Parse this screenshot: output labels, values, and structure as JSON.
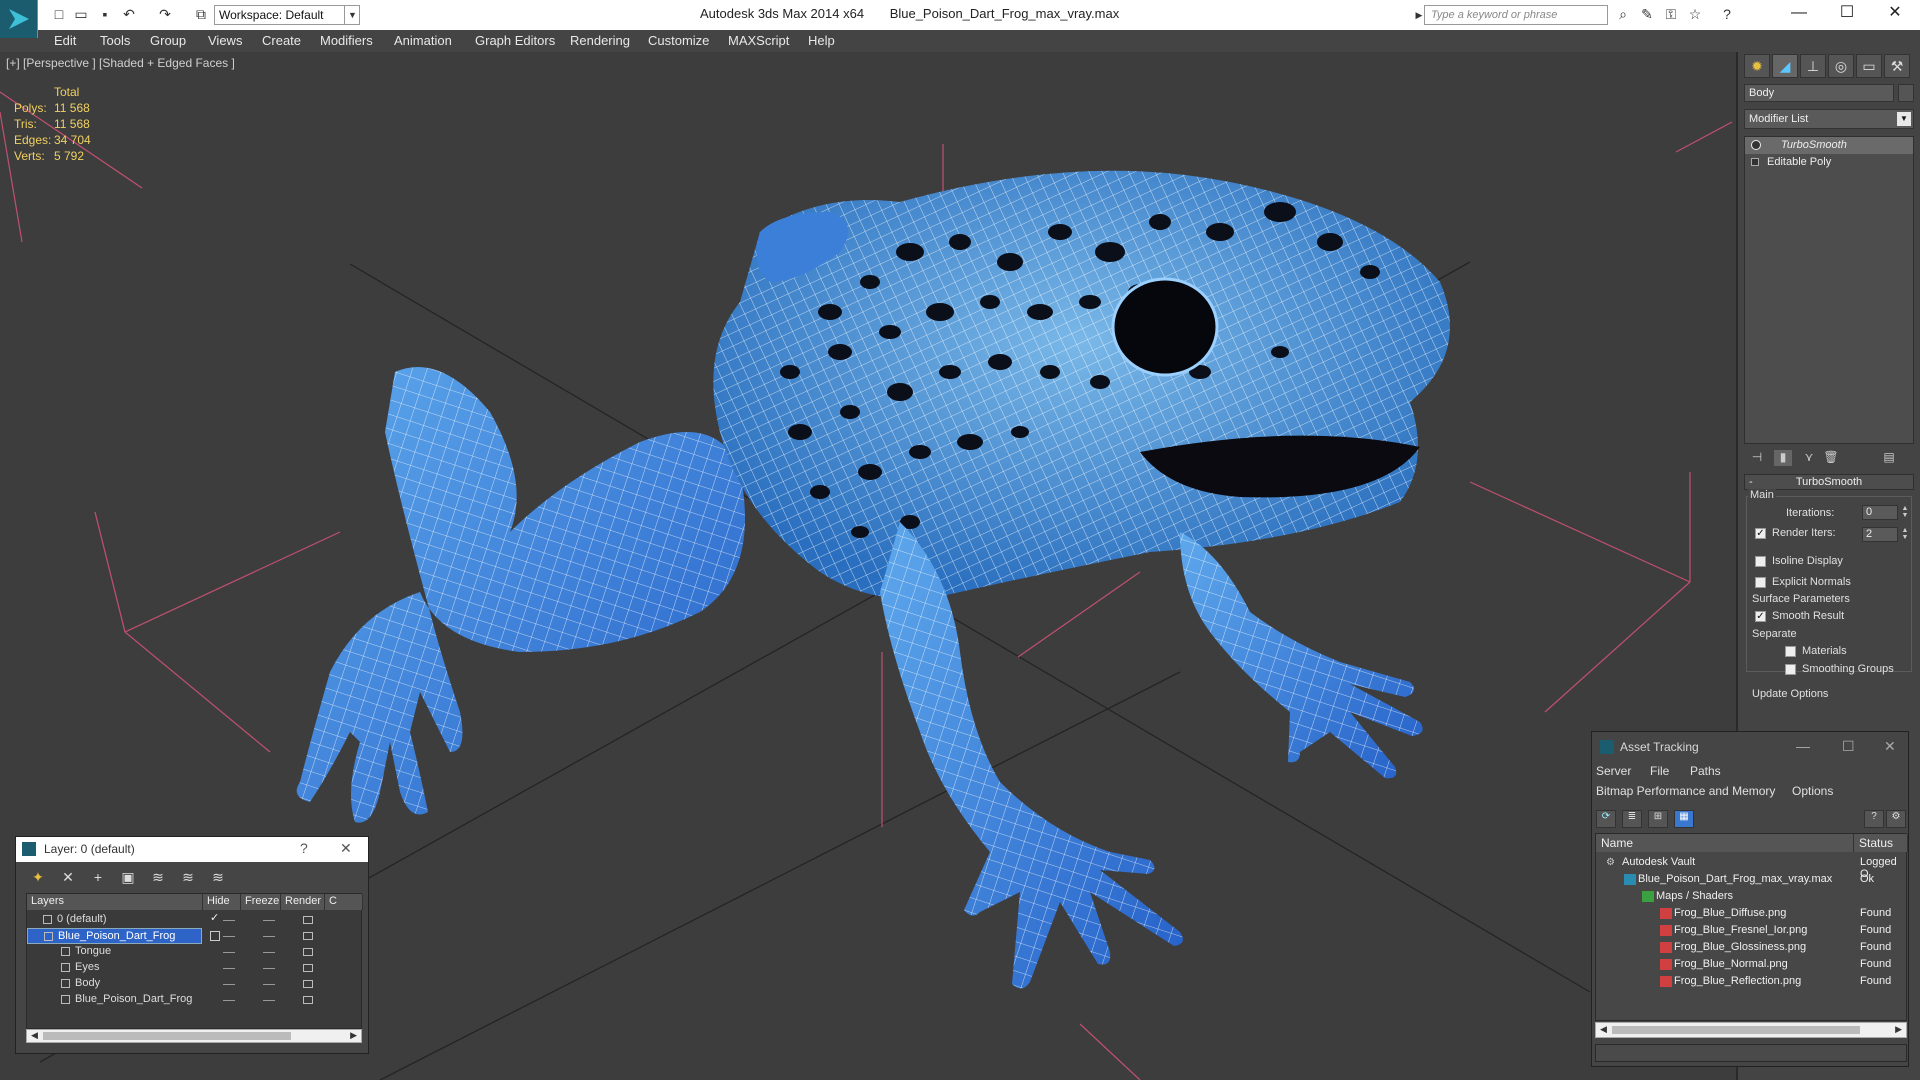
{
  "app": {
    "title": "Autodesk 3ds Max  2014 x64",
    "file": "Blue_Poison_Dart_Frog_max_vray.max"
  },
  "toolbar": {
    "workspace_label": "Workspace: Default",
    "search_placeholder": "Type a keyword or phrase"
  },
  "menu": {
    "items": [
      "Edit",
      "Tools",
      "Group",
      "Views",
      "Create",
      "Modifiers",
      "Animation",
      "Graph Editors",
      "Rendering",
      "Customize",
      "MAXScript",
      "Help"
    ]
  },
  "viewport": {
    "label": "[+] [Perspective ] [Shaded + Edged Faces ]",
    "stats": {
      "header": "Total",
      "rows": [
        {
          "k": "Polys:",
          "v": "11 568"
        },
        {
          "k": "Tris:",
          "v": "11 568"
        },
        {
          "k": "Edges:",
          "v": "34 704"
        },
        {
          "k": "Verts:",
          "v": "5 792"
        }
      ]
    }
  },
  "command_panel": {
    "object_name": "Body",
    "modifier_list": "Modifier List",
    "stack": [
      "TurboSmooth",
      "Editable Poly"
    ],
    "rollout": "TurboSmooth",
    "main_group": "Main",
    "iterations_label": "Iterations:",
    "iterations_value": "0",
    "render_iters_label": "Render Iters:",
    "render_iters_value": "2",
    "isoline": "Isoline Display",
    "explicit_normals": "Explicit Normals",
    "surface_params": "Surface Parameters",
    "smooth_result": "Smooth Result",
    "separate": "Separate",
    "materials": "Materials",
    "smoothing_groups": "Smoothing Groups",
    "update_options": "Update Options"
  },
  "layer_dialog": {
    "title": "Layer: 0 (default)",
    "columns": [
      "Layers",
      "Hide",
      "Freeze",
      "Render",
      "C"
    ],
    "rows": [
      {
        "name": "0 (default)",
        "indent": 0,
        "selected": false
      },
      {
        "name": "Blue_Poison_Dart_Frog",
        "indent": 0,
        "selected": true
      },
      {
        "name": "Tongue",
        "indent": 1,
        "selected": false
      },
      {
        "name": "Eyes",
        "indent": 1,
        "selected": false
      },
      {
        "name": "Body",
        "indent": 1,
        "selected": false
      },
      {
        "name": "Blue_Poison_Dart_Frog",
        "indent": 1,
        "selected": false
      }
    ]
  },
  "asset_dialog": {
    "title": "Asset Tracking",
    "menu1": [
      "Server",
      "File",
      "Paths"
    ],
    "menu2": [
      "Bitmap Performance and Memory",
      "Options"
    ],
    "columns": [
      "Name",
      "Status"
    ],
    "rows": [
      {
        "name": "Autodesk Vault",
        "status": "Logged O",
        "indent": 0,
        "icon": "vault"
      },
      {
        "name": "Blue_Poison_Dart_Frog_max_vray.max",
        "status": "Ok",
        "indent": 1,
        "icon": "max"
      },
      {
        "name": "Maps / Shaders",
        "status": "",
        "indent": 2,
        "icon": "maps"
      },
      {
        "name": "Frog_Blue_Diffuse.png",
        "status": "Found",
        "indent": 3,
        "icon": "png"
      },
      {
        "name": "Frog_Blue_Fresnel_Ior.png",
        "status": "Found",
        "indent": 3,
        "icon": "png"
      },
      {
        "name": "Frog_Blue_Glossiness.png",
        "status": "Found",
        "indent": 3,
        "icon": "png"
      },
      {
        "name": "Frog_Blue_Normal.png",
        "status": "Found",
        "indent": 3,
        "icon": "png"
      },
      {
        "name": "Frog_Blue_Reflection.png",
        "status": "Found",
        "indent": 3,
        "icon": "png"
      }
    ]
  },
  "colors": {
    "viewport_bg": "#3d3d3d",
    "stats": "#f0d060",
    "frog_blue": "#4a8fe0",
    "frog_spot": "#0b0f1a",
    "selection": "#2e64c8"
  }
}
